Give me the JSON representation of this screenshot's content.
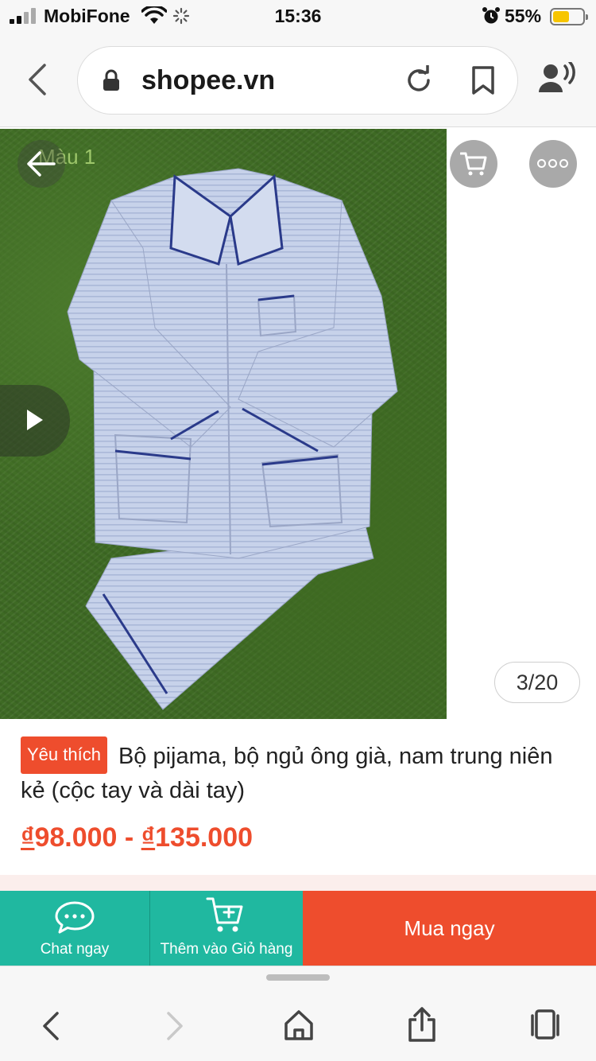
{
  "status_bar": {
    "carrier": "MobiFone",
    "time": "15:36",
    "battery_percent": "55%",
    "battery_level": 0.55,
    "icons": [
      "signal-icon",
      "wifi-icon",
      "activity-spinner-icon",
      "alarm-icon",
      "battery-icon"
    ]
  },
  "browser": {
    "url": "shopee.vn",
    "icons": [
      "back-icon",
      "lock-icon",
      "reload-icon",
      "bookmark-icon",
      "voice-icon"
    ]
  },
  "product_image": {
    "variant_label": "Màu 1",
    "counter": "3/20",
    "icons": [
      "back-arrow-icon",
      "play-icon",
      "cart-icon",
      "more-icon"
    ]
  },
  "product": {
    "badge": "Yêu thích",
    "title": "Bộ pijama, bộ ngủ ông già, nam trung niên kẻ (cộc tay và dài tay)",
    "price_currency": "₫",
    "price_min": "98.000",
    "price_separator": " - ",
    "price_max": "135.000"
  },
  "actions": {
    "chat_label": "Chat ngay",
    "add_to_cart_label": "Thêm vào Giỏ hàng",
    "buy_now_label": "Mua ngay",
    "icons": [
      "chat-icon",
      "add-to-cart-icon"
    ]
  },
  "toolbar": {
    "icons": [
      "back-icon",
      "forward-icon",
      "home-icon",
      "share-icon",
      "tabs-icon"
    ]
  },
  "colors": {
    "brand_orange": "#ee4d2d",
    "action_teal": "#20b8a0",
    "battery_yellow": "#f7c500"
  }
}
